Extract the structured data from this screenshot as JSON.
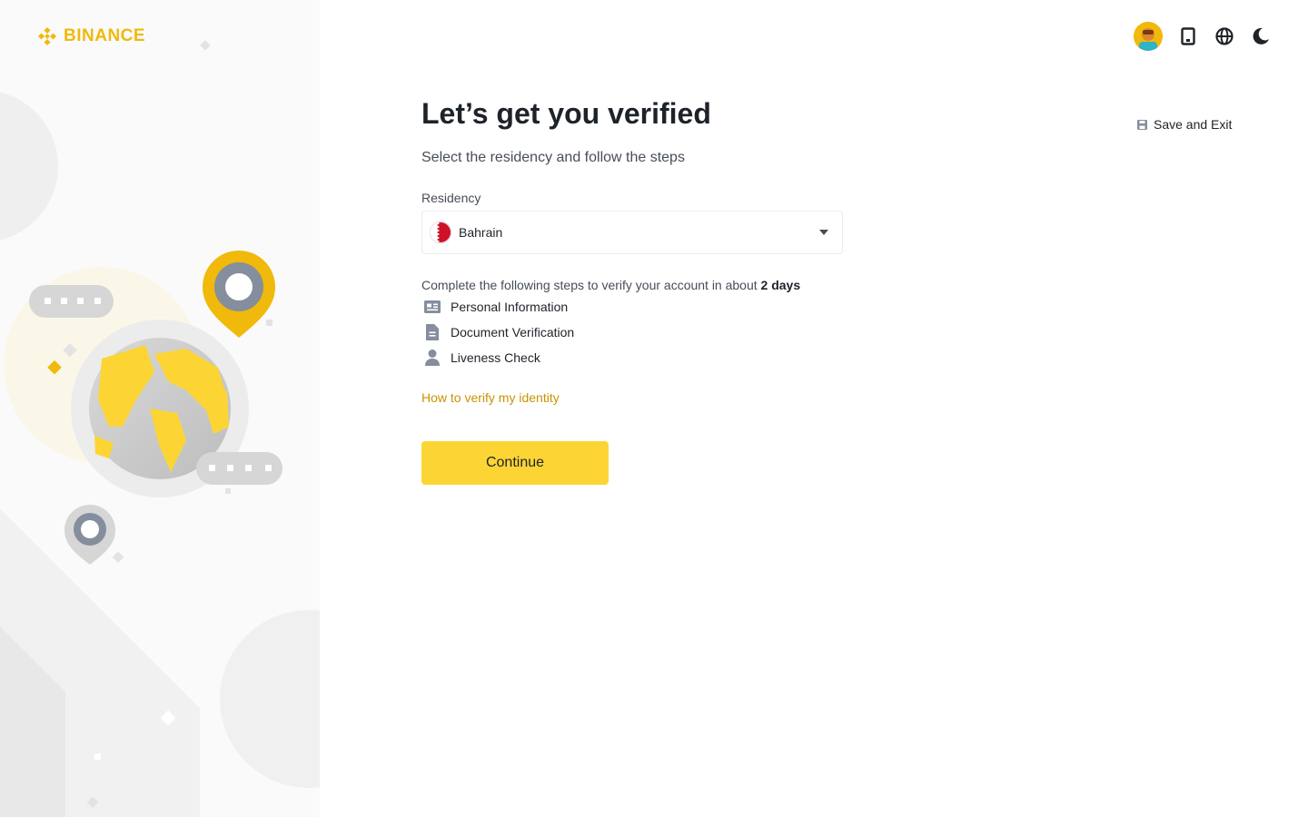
{
  "brand": {
    "name": "BINANCE",
    "accent": "#f0b90b"
  },
  "toolbar": {
    "avatar": "user-avatar",
    "icons": [
      "download-app-icon",
      "globe-icon",
      "dark-mode-icon"
    ]
  },
  "save_exit": {
    "label": "Save and Exit"
  },
  "main": {
    "title": "Let’s get you verified",
    "subtitle": "Select the residency and follow the steps",
    "residency_label": "Residency",
    "residency_value": "Bahrain",
    "steps_intro_prefix": "Complete the following steps to verify your account in about ",
    "steps_intro_duration": "2 days",
    "steps": [
      {
        "label": "Personal Information",
        "icon": "id-card-icon"
      },
      {
        "label": "Document Verification",
        "icon": "document-icon"
      },
      {
        "label": "Liveness Check",
        "icon": "person-icon"
      }
    ],
    "help_link": "How to verify my identity",
    "continue_label": "Continue"
  },
  "colors": {
    "primary_button": "#fcd535",
    "link": "#c99400",
    "text_primary": "#1e2329",
    "text_secondary": "#474d57"
  }
}
